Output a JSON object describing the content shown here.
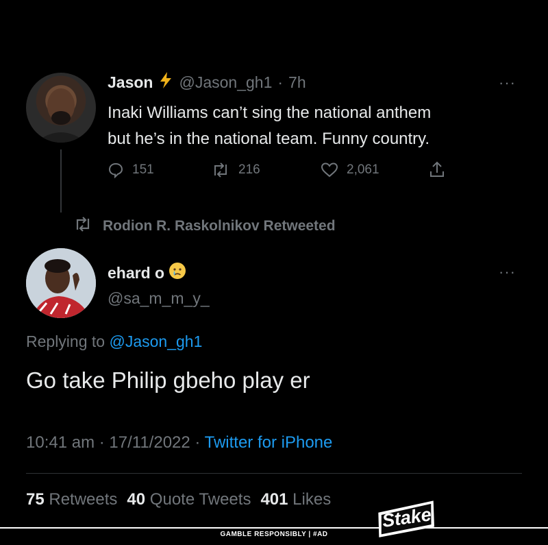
{
  "quoted_tweet": {
    "author_name": "Jason",
    "author_handle": "@Jason_gh1",
    "time": "7h",
    "text_line1": "Inaki Williams can’t sing the national anthem",
    "text_line2": "but he’s in the national team. Funny country.",
    "replies": "151",
    "retweets": "216",
    "likes": "2,061"
  },
  "retweet_banner": {
    "text": "Rodion R. Raskolnikov Retweeted"
  },
  "main_tweet": {
    "author_name": "ehard o",
    "author_handle": "@sa_m_m_y_",
    "replying_prefix": "Replying to",
    "replying_handle": "@Jason_gh1",
    "text": "Go take Philip gbeho play er",
    "timestamp": "10:41 am · 17/11/2022 · ",
    "source": "Twitter for iPhone",
    "stats": {
      "retweets_count": "75",
      "retweets_label": "Retweets",
      "quotes_count": "40",
      "quotes_label": "Quote Tweets",
      "likes_count": "401",
      "likes_label": "Likes"
    }
  },
  "footer": {
    "logo_text": "Stake",
    "gamble_text": "GAMBLE RESPONSIBLY | #AD"
  },
  "colors": {
    "background": "#000000",
    "text": "#e7e9ea",
    "muted": "#71767b",
    "accent": "#1d9bf0"
  }
}
